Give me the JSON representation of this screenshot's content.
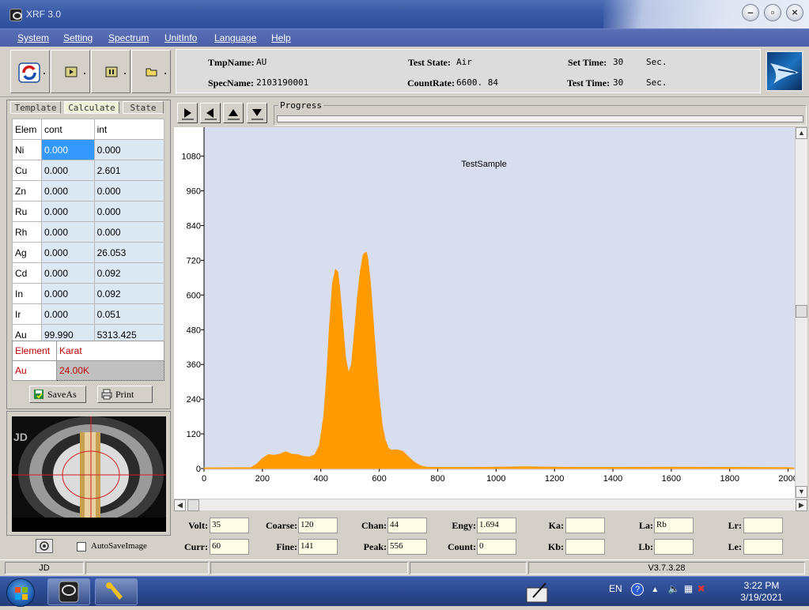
{
  "window": {
    "title": "XRF 3.0"
  },
  "menu": [
    "System",
    "Setting",
    "Spectrum",
    "UnitInfo",
    "Language",
    "Help"
  ],
  "info": {
    "tmpname_label": "TmpName:",
    "tmpname_value": "AU",
    "specname_label": "SpecName:",
    "specname_value": "2103190001",
    "teststate_label": "Test State:",
    "teststate_value": "Air",
    "countrate_label": "CountRate:",
    "countrate_value": "6600. 84",
    "settime_label": "Set Time:",
    "settime_value": "30",
    "settime_unit": "Sec.",
    "testtime_label": "Test Time:",
    "testtime_value": "30",
    "testtime_unit": "Sec."
  },
  "tabs": [
    "Template",
    "Calculate",
    "State"
  ],
  "grid": {
    "headers": [
      "Elem",
      "cont",
      "int"
    ],
    "rows": [
      [
        "Ni",
        "0.000",
        "0.000"
      ],
      [
        "Cu",
        "0.000",
        "2.601"
      ],
      [
        "Zn",
        "0.000",
        "0.000"
      ],
      [
        "Ru",
        "0.000",
        "0.000"
      ],
      [
        "Rh",
        "0.000",
        "0.000"
      ],
      [
        "Ag",
        "0.000",
        "26.053"
      ],
      [
        "Cd",
        "0.000",
        "0.092"
      ],
      [
        "In",
        "0.000",
        "0.092"
      ],
      [
        "Ir",
        "0.000",
        "0.051"
      ],
      [
        "Au",
        "99.990",
        "5313.425"
      ]
    ]
  },
  "karat": {
    "header_element": "Element",
    "header_karat": "Karat",
    "element": "Au",
    "value": "24.00K"
  },
  "buttons": {
    "saveas": "SaveAs",
    "print": "Print"
  },
  "camera": {
    "label": "JD"
  },
  "autosave_label": "AutoSaveImage",
  "progress_label": "Progress",
  "chart_data": {
    "type": "area",
    "title": "TestSample",
    "xlim": [
      0,
      2020
    ],
    "ylim": [
      0,
      1180
    ],
    "xticks": [
      0,
      200,
      400,
      600,
      800,
      1000,
      1200,
      1400,
      1600,
      1800,
      2000
    ],
    "yticks": [
      0,
      120,
      240,
      360,
      480,
      600,
      720,
      840,
      960,
      1080
    ],
    "fill_color": "#ff9a00",
    "x": [
      0,
      160,
      180,
      200,
      220,
      240,
      260,
      280,
      300,
      320,
      340,
      360,
      380,
      395,
      410,
      420,
      430,
      440,
      450,
      458,
      465,
      475,
      485,
      495,
      505,
      515,
      525,
      535,
      545,
      555,
      560,
      570,
      580,
      590,
      600,
      610,
      620,
      630,
      640,
      660,
      680,
      700,
      720,
      740,
      760,
      800,
      900,
      1000,
      1100,
      1200,
      1300,
      1400,
      1600,
      1800,
      2000,
      2020
    ],
    "y": [
      2,
      3,
      15,
      35,
      48,
      46,
      50,
      58,
      50,
      48,
      42,
      40,
      48,
      80,
      180,
      320,
      500,
      640,
      688,
      680,
      620,
      500,
      380,
      330,
      360,
      470,
      590,
      680,
      740,
      748,
      730,
      640,
      500,
      360,
      240,
      150,
      100,
      72,
      64,
      65,
      60,
      40,
      22,
      10,
      5,
      4,
      4,
      5,
      6,
      5,
      4,
      4,
      5,
      4,
      3,
      2
    ]
  },
  "params": {
    "volt_label": "Volt:",
    "volt": "35",
    "curr_label": "Curr:",
    "curr": "60",
    "coarse_label": "Coarse:",
    "coarse": "120",
    "fine_label": "Fine:",
    "fine": "141",
    "chan_label": "Chan:",
    "chan": "44",
    "peak_label": "Peak:",
    "peak": "556",
    "engy_label": "Engy:",
    "engy": "1.694",
    "count_label": "Count:",
    "count": "0",
    "ka_label": "Ka:",
    "ka": "",
    "kb_label": "Kb:",
    "kb": "",
    "la_label": "La:",
    "la": "Rb",
    "lb_label": "Lb:",
    "lb": "",
    "lr_label": "Lr:",
    "lr": "",
    "le_label": "Le:",
    "le": ""
  },
  "status": {
    "left": "JD",
    "version": "V3.7.3.28"
  },
  "taskbar": {
    "lang": "EN",
    "time": "3:22 PM",
    "date": "3/19/2021"
  }
}
